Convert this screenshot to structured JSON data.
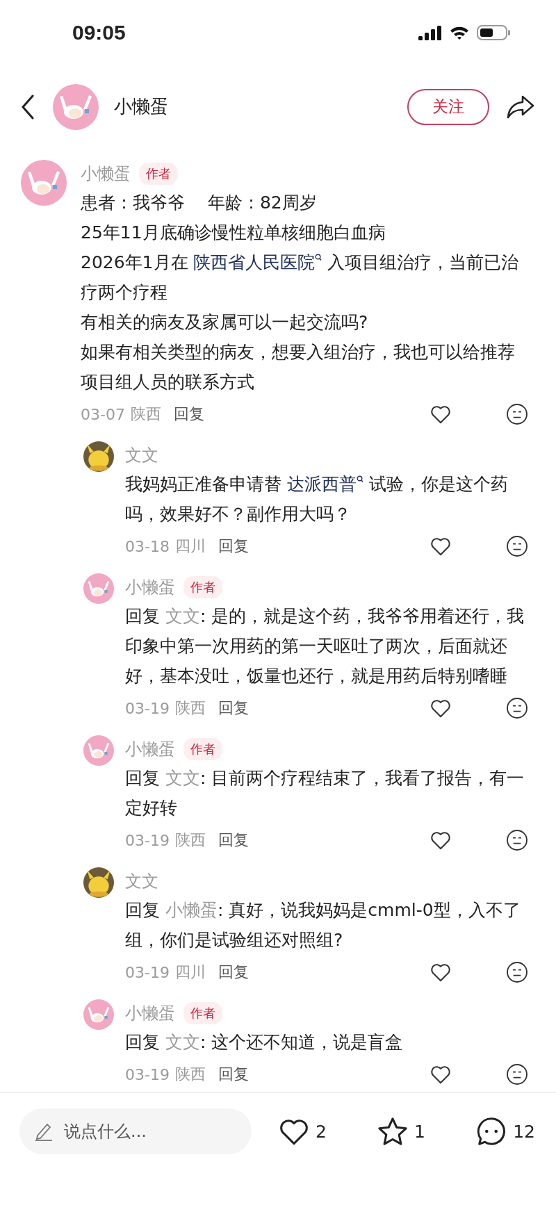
{
  "status_bar": {
    "time": "09:05"
  },
  "header": {
    "title": "小懒蛋",
    "avatar": {
      "kind": "pink"
    },
    "follow_button": "关注"
  },
  "post": {
    "name": "小懒蛋",
    "avatar": {
      "kind": "pink"
    },
    "badge": "作者",
    "paragraphs": [
      [
        {
          "kind": "text",
          "text": "患者：我爷爷　 年龄：82周岁"
        }
      ],
      [
        {
          "kind": "text",
          "text": "25年11月底确诊慢性粒单核细胞白血病"
        }
      ],
      [
        {
          "kind": "text",
          "text": "2026年1月在 "
        },
        {
          "kind": "link",
          "text": "陕西省人民医院"
        },
        {
          "kind": "text",
          "text": " 入项目组治疗，当前已治疗两个疗程"
        }
      ],
      [
        {
          "kind": "text",
          "text": "有相关的病友及家属可以一起交流吗?"
        }
      ],
      [
        {
          "kind": "text",
          "text": "如果有相关类型的病友，想要入组治疗，我也可以给推荐项目组人员的联系方式"
        }
      ]
    ],
    "date": "03-07",
    "location": "陕西",
    "reply_button": "回复",
    "replies": [
      {
        "name": "文文",
        "avatar": {
          "kind": "yellow"
        },
        "paragraphs": [
          [
            {
              "kind": "text",
              "text": "我妈妈正准备申请替 "
            },
            {
              "kind": "link",
              "text": "达派西普"
            },
            {
              "kind": "text",
              "text": " 试验，你是这个药吗，效果好不？副作用大吗？"
            }
          ]
        ],
        "date": "03-18",
        "location": "四川",
        "reply_button": "回复"
      },
      {
        "name": "小懒蛋",
        "avatar": {
          "kind": "pink"
        },
        "badge": "作者",
        "paragraphs": [
          [
            {
              "kind": "text",
              "text": "回复 "
            },
            {
              "kind": "mention",
              "text": "文文"
            },
            {
              "kind": "text",
              "text": ": 是的，就是这个药，我爷爷用着还行，我印象中第一次用药的第一天呕吐了两次，后面就还好，基本没吐，饭量也还行，就是用药后特别嗜睡"
            }
          ]
        ],
        "date": "03-19",
        "location": "陕西",
        "reply_button": "回复"
      },
      {
        "name": "小懒蛋",
        "avatar": {
          "kind": "pink"
        },
        "badge": "作者",
        "paragraphs": [
          [
            {
              "kind": "text",
              "text": "回复 "
            },
            {
              "kind": "mention",
              "text": "文文"
            },
            {
              "kind": "text",
              "text": ": 目前两个疗程结束了，我看了报告，有一定好转"
            }
          ]
        ],
        "date": "03-19",
        "location": "陕西",
        "reply_button": "回复"
      },
      {
        "name": "文文",
        "avatar": {
          "kind": "yellow"
        },
        "paragraphs": [
          [
            {
              "kind": "text",
              "text": "回复 "
            },
            {
              "kind": "mention",
              "text": "小懒蛋"
            },
            {
              "kind": "text",
              "text": ": 真好，说我妈妈是cmml-0型，入不了组，你们是试验组还对照组?"
            }
          ]
        ],
        "date": "03-19",
        "location": "四川",
        "reply_button": "回复"
      },
      {
        "name": "小懒蛋",
        "avatar": {
          "kind": "pink"
        },
        "badge": "作者",
        "paragraphs": [
          [
            {
              "kind": "text",
              "text": "回复 "
            },
            {
              "kind": "mention",
              "text": "文文"
            },
            {
              "kind": "text",
              "text": ": 这个还不知道，说是盲盒"
            }
          ]
        ],
        "date": "03-19",
        "location": "陕西",
        "reply_button": "回复"
      }
    ]
  },
  "bottom_bar": {
    "placeholder": "说点什么...",
    "likes": "2",
    "stars": "1",
    "comments": "12"
  }
}
